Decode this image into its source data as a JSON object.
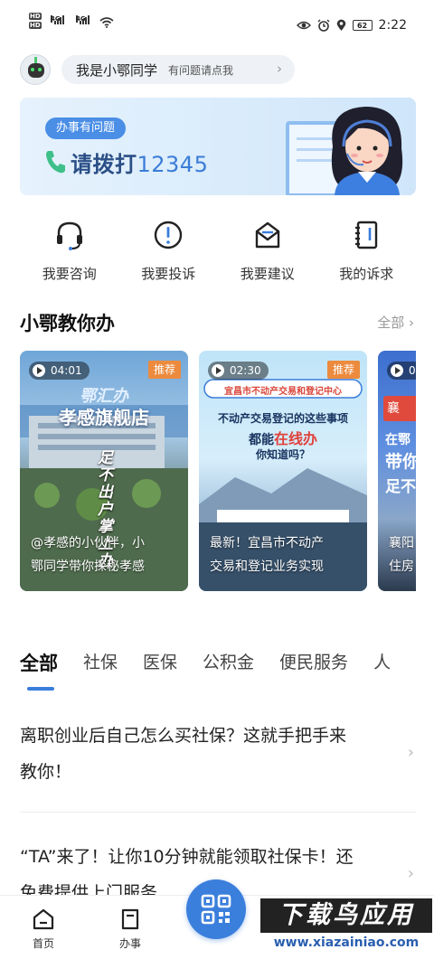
{
  "status_bar": {
    "sim1_label": "HD",
    "sim2_label": "HD",
    "net1": "4G",
    "net2": "4G",
    "battery": "62",
    "time": "2:22"
  },
  "assistant": {
    "title": "我是小鄂同学",
    "subtitle": "有问题请点我"
  },
  "banner": {
    "ribbon": "办事有问题",
    "call_text": "请拨打",
    "call_number": "12345"
  },
  "quick_actions": [
    {
      "label": "我要咨询",
      "icon": "headset-icon"
    },
    {
      "label": "我要投诉",
      "icon": "alert-icon"
    },
    {
      "label": "我要建议",
      "icon": "envelope-icon"
    },
    {
      "label": "我的诉求",
      "icon": "notebook-icon"
    }
  ],
  "section": {
    "title": "小鄂教你办",
    "more": "全部"
  },
  "videos": [
    {
      "duration": "04:01",
      "badge": "推荐",
      "headline_top": "鄂汇办",
      "headline": "孝感旗舰店",
      "vertical_text": "足不出户掌上办",
      "caption_line1": "@孝感的小伙伴，小",
      "caption_line2": "鄂同学带你探秘孝感"
    },
    {
      "duration": "02:30",
      "badge": "推荐",
      "headline_top": "宜昌市不动产交易和登记中心",
      "headline_a": "不动产交易登记的这些事项",
      "headline_b1": "都能",
      "headline_b2": "在线办",
      "headline_c": "你知道吗？",
      "caption_line1": "最新！宜昌市不动产",
      "caption_line2": "交易和登记业务实现"
    },
    {
      "duration": "0",
      "side_top": "襄",
      "side_mid": "在鄂",
      "side_big": "带你",
      "side_low": "足不",
      "caption_line1": "襄阳",
      "caption_line2": "住房"
    }
  ],
  "tabs": [
    "全部",
    "社保",
    "医保",
    "公积金",
    "便民服务",
    "人"
  ],
  "news": [
    {
      "line1": "离职创业后自己怎么买社保？这就手把手来",
      "line2": "教你！"
    },
    {
      "line1": "“TA”来了！让你10分钟就能领取社保卡！还",
      "line2": "免费提供上门服务"
    }
  ],
  "bottom_nav": {
    "home": "首页",
    "services": "办事"
  },
  "watermark": {
    "main": "下载鸟应用",
    "url": "www.xiazainiao.com"
  },
  "colors": {
    "accent": "#3a7ddb",
    "badge": "#ec8a3d"
  }
}
